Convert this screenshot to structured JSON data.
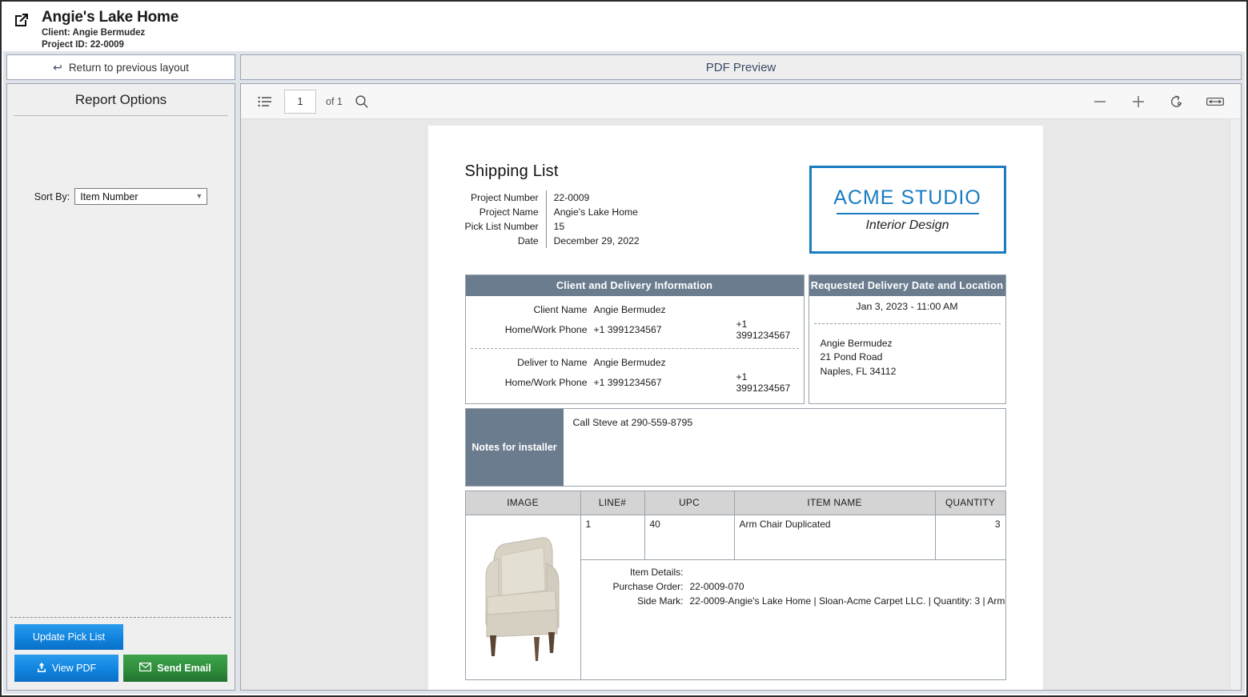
{
  "header": {
    "icon": "external-link-icon",
    "project_title": "Angie's Lake Home",
    "client_line": "Client: Angie Bermudez",
    "project_id_line": "Project ID: 22-0009"
  },
  "sidebar": {
    "return_button": "Return to previous layout",
    "return_icon": "back-arrow-icon",
    "panel_title": "Report Options",
    "sort_by_label": "Sort By:",
    "sort_by_value": "Item Number",
    "sort_by_options": [
      "Item Number"
    ],
    "buttons": {
      "update_pick_list": "Update Pick List",
      "view_pdf": "View PDF",
      "view_pdf_icon": "upload-icon",
      "send_email": "Send Email",
      "send_email_icon": "envelope-icon"
    },
    "colors": {
      "blue": "#1186e0",
      "green": "#2f8d3c"
    }
  },
  "preview": {
    "title": "PDF Preview",
    "toolbar": {
      "sidebar_toggle_icon": "list-view-icon",
      "page_number": "1",
      "page_of": "of 1",
      "search_icon": "search-icon",
      "zoom_out_icon": "minus-icon",
      "zoom_in_icon": "plus-icon",
      "rotate_icon": "rotate-icon",
      "fit_width_icon": "fit-width-icon"
    }
  },
  "document": {
    "title": "Shipping List",
    "meta": [
      {
        "label": "Project Number",
        "value": "22-0009"
      },
      {
        "label": "Project Name",
        "value": "Angie's Lake Home"
      },
      {
        "label": "Pick List Number",
        "value": "15"
      },
      {
        "label": "Date",
        "value": "December 29, 2022"
      }
    ],
    "logo": {
      "main": "ACME STUDIO",
      "sub": "Interior Design",
      "color": "#1a7cc0"
    },
    "client_card": {
      "header": "Client and Delivery Information",
      "rows": [
        {
          "label": "Client Name",
          "value": "Angie Bermudez",
          "value2": ""
        },
        {
          "label": "Home/Work Phone",
          "value": "+1 3991234567",
          "value2": "+1 3991234567"
        }
      ],
      "rows2": [
        {
          "label": "Deliver to Name",
          "value": "Angie Bermudez",
          "value2": ""
        },
        {
          "label": "Home/Work Phone",
          "value": "+1 3991234567",
          "value2": "+1 3991234567"
        }
      ]
    },
    "delivery_card": {
      "header": "Requested Delivery Date and Location",
      "datetime": "Jan 3, 2023 - 11:00 AM",
      "address_line1": "Angie Bermudez",
      "address_line2": "21 Pond Road",
      "address_line3": "Naples, FL 34112"
    },
    "notes": {
      "label": "Notes for installer",
      "text": "Call Steve at  290-559-8795"
    },
    "items_table": {
      "columns": [
        "IMAGE",
        "LINE#",
        "UPC",
        "ITEM NAME",
        "QUANTITY"
      ],
      "rows": [
        {
          "image_alt": "arm-chair-photo",
          "line": "1",
          "upc": "40",
          "item_name": "Arm Chair Duplicated",
          "quantity": "3",
          "details": [
            {
              "label": "Item Details:",
              "value": ""
            },
            {
              "label": "Purchase Order:",
              "value": "22-0009-070"
            },
            {
              "label": "Side Mark:",
              "value": "22-0009-Angie's Lake Home | Sloan-Acme Carpet LLC. | Quantity: 3 | Arm"
            }
          ]
        }
      ]
    }
  }
}
